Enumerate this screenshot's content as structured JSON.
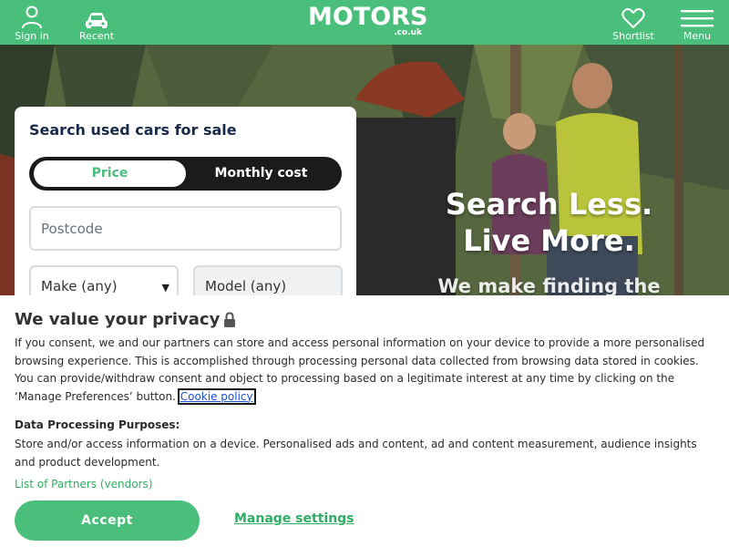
{
  "header": {
    "sign_in": "Sign in",
    "recent": "Recent",
    "logo_main": "MOTORS",
    "logo_sub": ".co.uk",
    "shortlist": "Shortlist",
    "menu": "Menu",
    "bg_color": "#49bf7b"
  },
  "hero": {
    "line1": "Search Less.",
    "line2": "Live More.",
    "sub": "We make finding the"
  },
  "search": {
    "title": "Search used cars for sale",
    "toggle": {
      "price": "Price",
      "monthly": "Monthly cost",
      "active": "Price"
    },
    "postcode_placeholder": "Postcode",
    "make": "Make (any)",
    "model": "Model (any)"
  },
  "cookie": {
    "title": "We value your privacy",
    "body": "If you consent, we and our partners can store and access personal information on your device to provide a more personalised browsing experience. This is accomplished through processing personal data collected from browsing data stored in cookies. You can provide/withdraw consent and object to processing based on a legitimate interest at any time by clicking on the ‘Manage Preferences’ button.",
    "policy_link": "Cookie policy",
    "purposes_title": "Data Processing Purposes:",
    "purposes_body": "Store and/or access information on a device. Personalised ads and content, ad and content measurement, audience insights and product development.",
    "partners_link": "List of Partners (vendors)",
    "accept": "Accept",
    "manage": "Manage settings",
    "accent": "#49bf7b"
  }
}
